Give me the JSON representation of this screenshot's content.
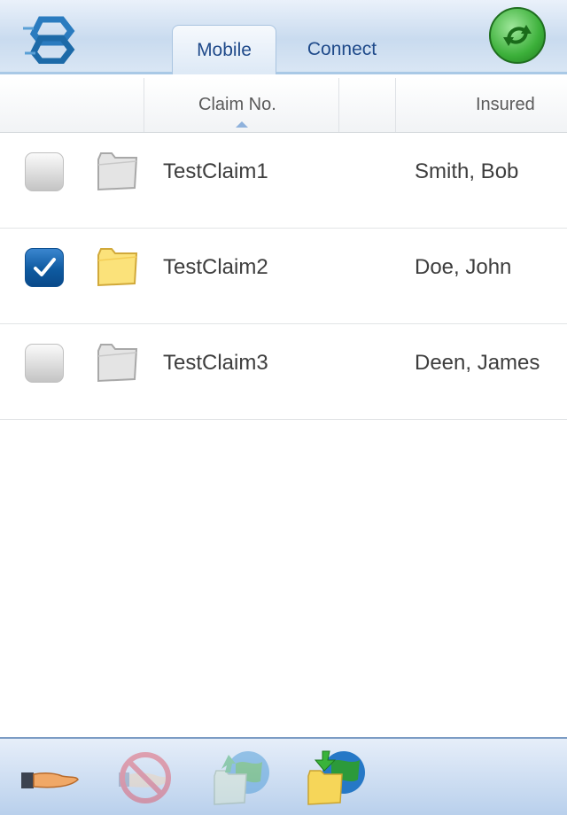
{
  "topbar": {
    "logo": "hexagon-chain-logo",
    "tabs": [
      {
        "label": "Mobile",
        "active": true
      },
      {
        "label": "Connect",
        "active": false
      }
    ],
    "sync_button": "sync-icon"
  },
  "table": {
    "columns": [
      {
        "label": ""
      },
      {
        "label": "Claim No.",
        "sorted": "ascending"
      },
      {
        "label": ""
      },
      {
        "label": "Insured"
      }
    ],
    "rows": [
      {
        "checked": false,
        "folder": "folder-gray",
        "claim_no": "TestClaim1",
        "insured": "Smith, Bob"
      },
      {
        "checked": true,
        "folder": "folder-yellow",
        "claim_no": "TestClaim2",
        "insured": "Doe, John"
      },
      {
        "checked": false,
        "folder": "folder-gray",
        "claim_no": "TestClaim3",
        "insured": "Deen, James"
      }
    ]
  },
  "toolbar": {
    "buttons": [
      {
        "icon": "hand-icon",
        "enabled": true
      },
      {
        "icon": "no-hand-icon",
        "enabled": false
      },
      {
        "icon": "upload-globe-icon",
        "enabled": false
      },
      {
        "icon": "download-globe-icon",
        "enabled": true
      }
    ]
  },
  "colors": {
    "tab_text": "#1f4a8a",
    "checkbox_checked": "#0e5aa0",
    "sync_green": "#3cb03a"
  }
}
